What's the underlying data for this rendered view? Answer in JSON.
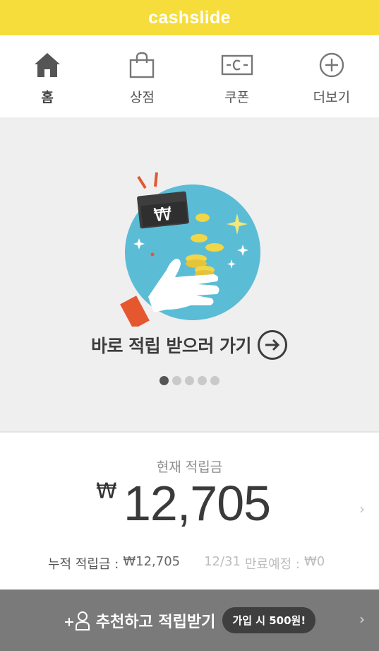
{
  "app": {
    "brand": "cashslide"
  },
  "nav": {
    "items": [
      {
        "label": "홈",
        "icon": "home-icon",
        "active": true
      },
      {
        "label": "상점",
        "icon": "shopping-bag-icon",
        "active": false
      },
      {
        "label": "쿠폰",
        "icon": "coupon-icon",
        "active": false
      },
      {
        "label": "더보기",
        "icon": "plus-circle-icon",
        "active": false
      }
    ]
  },
  "banner": {
    "cta": "바로 적립 받으러 가기",
    "wallet_symbol": "₩",
    "slides": 5,
    "active_slide": 1
  },
  "balance": {
    "label": "현재 적립금",
    "currency": "₩",
    "amount": "12,705",
    "accumulated_label": "누적 적립금 :",
    "accumulated_value": "₩12,705",
    "expiry_date": "12/31",
    "expiry_label": "만료예정 :",
    "expiry_value": "₩0"
  },
  "refer": {
    "text": "추천하고 적립받기",
    "badge": "가입 시 500원!"
  },
  "colors": {
    "brand_yellow": "#f6dd3b",
    "circle_blue": "#5bbcd6",
    "coin_yellow": "#f1d648",
    "accent_orange": "#e5572f"
  }
}
